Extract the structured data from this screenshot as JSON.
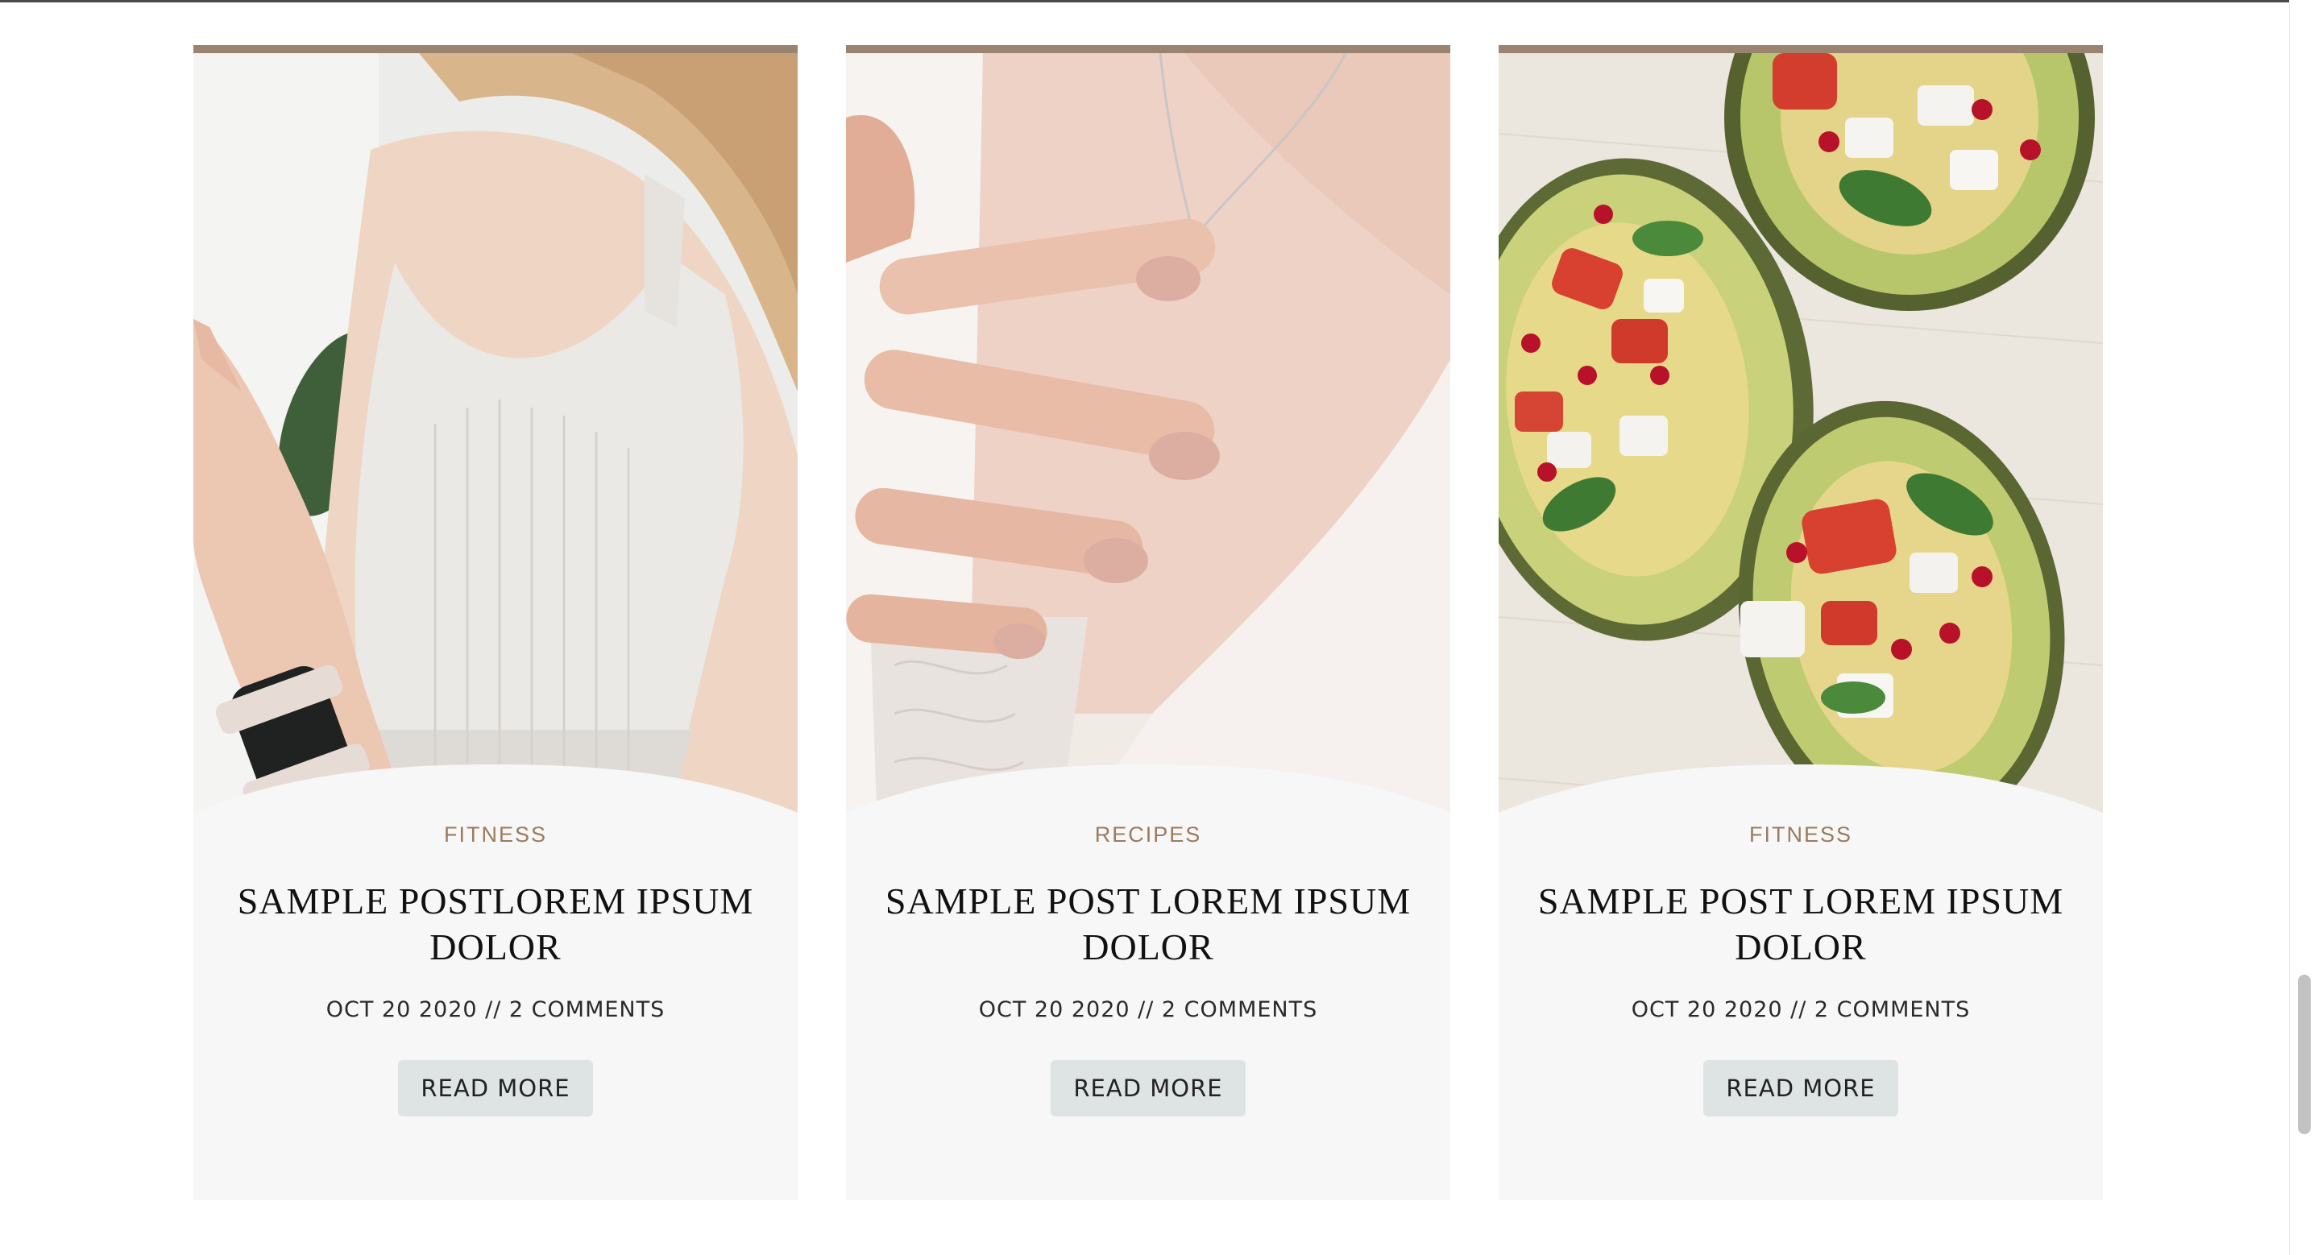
{
  "colors": {
    "accent_bar": "#9a8470",
    "category_text": "#9a7b5f",
    "card_bg": "#f7f7f7",
    "button_bg": "#dee3e3"
  },
  "cards": [
    {
      "category": "FITNESS",
      "title": "SAMPLE POSTLOREM IPSUM DOLOR",
      "meta": "OCT 20 2020 // 2 COMMENTS",
      "button": "READ MORE",
      "image": "woman-in-sports-bra-with-smartwatch-photo"
    },
    {
      "category": "RECIPES",
      "title": "SAMPLE POST LOREM IPSUM DOLOR",
      "meta": "OCT 20 2020 // 2 COMMENTS",
      "button": "READ MORE",
      "image": "hand-touching-heart-necklace-photo"
    },
    {
      "category": "FITNESS",
      "title": "SAMPLE POST LOREM IPSUM DOLOR",
      "meta": "OCT 20 2020 // 2 COMMENTS",
      "button": "READ MORE",
      "image": "stuffed-avocado-salad-photo"
    }
  ]
}
